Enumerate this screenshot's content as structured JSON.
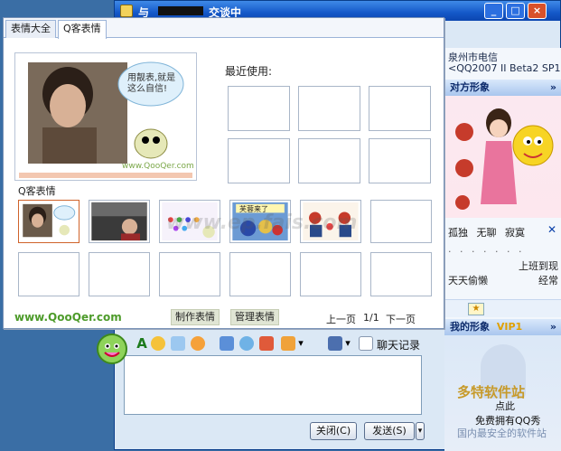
{
  "chat_window": {
    "title_prefix": "与",
    "title_suffix": "交谈中",
    "buttons": {
      "minimize": "_",
      "maximize": "□",
      "close": "×"
    }
  },
  "contact_panel": {
    "location_line": "泉州市电信",
    "client_line": "<QQ2007 II Beta2 SP1>",
    "their_avatar_title": "对方形象",
    "moods": [
      "孤独",
      "无聊",
      "寂寞"
    ],
    "status_lines": [
      "上班到现",
      "经常",
      "天天偷懒"
    ],
    "my_avatar_title": "我的形象",
    "vip_badge": "VIP1",
    "promo_line1": "点此",
    "promo_line2": "免费拥有QQ秀",
    "watermark1": "多特软件站",
    "watermark2": "国内最安全的软件站"
  },
  "toolbar": {
    "font_button": "A",
    "chat_history": "聊天记录"
  },
  "send_area": {
    "close_button": "关闭(C)",
    "send_button": "发送(S)"
  },
  "emoticon_popup": {
    "tabs": [
      {
        "label": "表情大全",
        "active": false
      },
      {
        "label": "Q客表情",
        "active": true
      }
    ],
    "preview_bubble": "用靓表,就是这么自信!",
    "preview_watermark": "www.QooQer.com",
    "recent_label": "最近使用:",
    "section_label": "Q客表情",
    "thumb_captions": [
      "芙蓉来了"
    ],
    "brand": "www.QooQer.com",
    "make_button": "制作表情",
    "manage_button": "管理表情",
    "prev_page": "上一页",
    "page_indicator": "1/1",
    "next_page": "下一页",
    "center_watermark": "www.ep.fais.com"
  }
}
